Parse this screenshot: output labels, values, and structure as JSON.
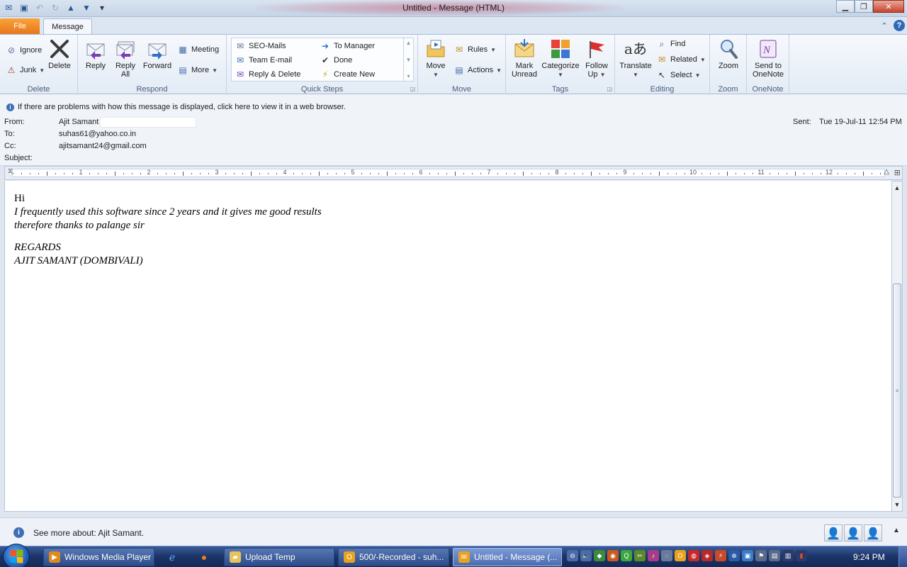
{
  "window": {
    "title": "Untitled  -  Message (HTML)"
  },
  "tabs": {
    "file": "File",
    "message": "Message"
  },
  "ribbon": {
    "delete_group": {
      "label": "Delete",
      "ignore": "Ignore",
      "junk": "Junk",
      "delete": "Delete"
    },
    "respond_group": {
      "label": "Respond",
      "reply": "Reply",
      "reply_all_1": "Reply",
      "reply_all_2": "All",
      "forward": "Forward",
      "meeting": "Meeting",
      "more": "More"
    },
    "quicksteps_group": {
      "label": "Quick Steps",
      "items": [
        "SEO-Mails",
        "To Manager",
        "Team E-mail",
        "Done",
        "Reply & Delete",
        "Create New"
      ]
    },
    "move_group": {
      "label": "Move",
      "move": "Move",
      "rules": "Rules",
      "actions": "Actions"
    },
    "tags_group": {
      "label": "Tags",
      "mark_1": "Mark",
      "mark_2": "Unread",
      "categorize": "Categorize",
      "follow_1": "Follow",
      "follow_2": "Up"
    },
    "editing_group": {
      "label": "Editing",
      "translate": "Translate",
      "find": "Find",
      "related": "Related",
      "select": "Select"
    },
    "zoom_group": {
      "label": "Zoom",
      "zoom": "Zoom"
    },
    "onenote_group": {
      "label": "OneNote",
      "send_1": "Send to",
      "send_2": "OneNote"
    }
  },
  "message": {
    "info": "If there are problems with how this message is displayed, click here to view it in a web browser.",
    "from_label": "From:",
    "from_value": "Ajit Samant",
    "to_label": "To:",
    "to_value": "suhas61@yahoo.co.in",
    "cc_label": "Cc:",
    "cc_value": "ajitsamant24@gmail.com",
    "subject_label": "Subject:",
    "subject_value": "",
    "sent_label": "Sent:",
    "sent_value": "Tue 19-Jul-11 12:54 PM"
  },
  "ruler": {
    "numbers": [
      "1",
      "2",
      "3",
      "4",
      "5",
      "6",
      "7",
      "8",
      "9",
      "10",
      "11",
      "12"
    ]
  },
  "body": {
    "line1": "Hi",
    "line2": "I frequently used this software since 2 years and it gives me good results",
    "line3": "therefore thanks to palange sir",
    "line4": "REGARDS",
    "line5": "AJIT SAMANT (DOMBIVALI)"
  },
  "people_pane": {
    "text": "See more about: Ajit Samant."
  },
  "taskbar": {
    "items": [
      {
        "label": "Windows Media Player",
        "color": "#e08a1e"
      },
      {
        "label": "Upload Temp",
        "color": "#e8c35a"
      },
      {
        "label": "500/-Recorded - suh...",
        "color": "#e8a31e"
      },
      {
        "label": "Untitled - Message (...",
        "color": "#e8a31e"
      }
    ],
    "clock": "9:24 PM"
  },
  "colors": {
    "file_tab": "#e8761b",
    "accent": "#2b5797"
  }
}
